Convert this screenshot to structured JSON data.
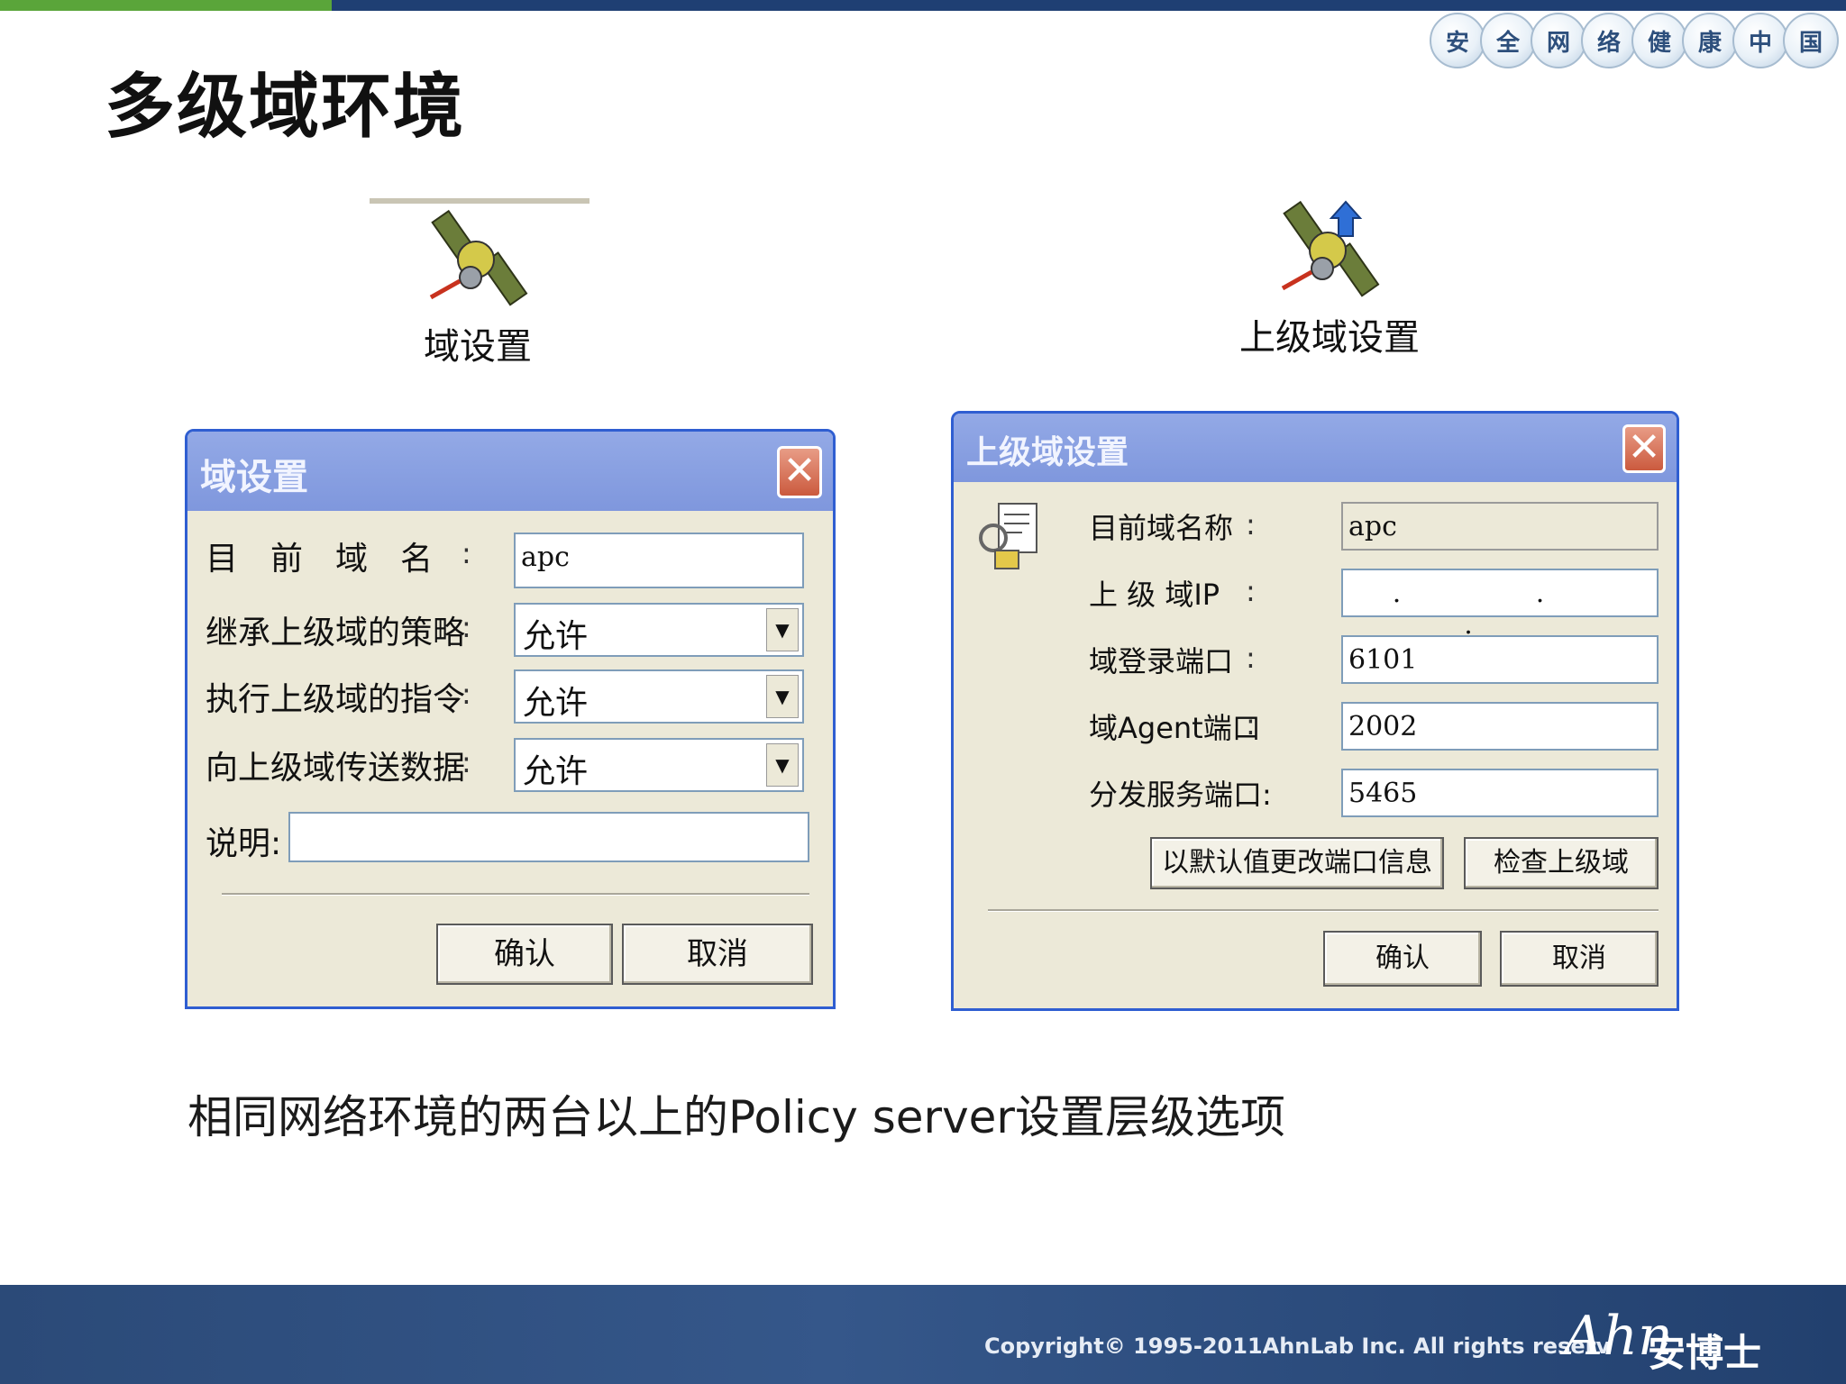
{
  "slogan": [
    "安",
    "全",
    "网",
    "络",
    "健",
    "康",
    "中",
    "国"
  ],
  "page_title": "多级域环境",
  "icons": {
    "domain_settings_label": "域设置",
    "parent_domain_settings_label": "上级域设置"
  },
  "domain_dialog": {
    "title": "域设置",
    "close_glyph": "✕",
    "current_domain_label": "目　前　域　名",
    "current_domain_value": "apc",
    "inherit_policy_label": "继承上级域的策略",
    "inherit_policy_value": "允许",
    "exec_command_label": "执行上级域的指令",
    "exec_command_value": "允许",
    "send_data_label": "向上级域传送数据",
    "send_data_value": "允许",
    "description_label": "说明:",
    "description_value": "",
    "ok_label": "确认",
    "cancel_label": "取消"
  },
  "parent_dialog": {
    "title": "上级域设置",
    "close_glyph": "✕",
    "current_domain_name_label": "目前域名称",
    "current_domain_name_value": "apc",
    "parent_ip_label": "上 级 域IP",
    "parent_ip_value": ". . .",
    "login_port_label": "域登录端口",
    "login_port_value": "6101",
    "agent_port_label": "域Agent端口",
    "agent_port_value": "2002",
    "dist_port_label": "分发服务端口:",
    "dist_port_value": "5465",
    "default_ports_button": "以默认值更改端口信息",
    "check_parent_button": "检查上级域",
    "ok_label": "确认",
    "cancel_label": "取消"
  },
  "caption": "相同网络环境的两台以上的Policy server设置层级选项",
  "footer": {
    "copyright": "Copyright© 1995-2011AhnLab Inc. All rights reserv",
    "logo_mark": "Ahn",
    "logo_cn": "安博士"
  }
}
